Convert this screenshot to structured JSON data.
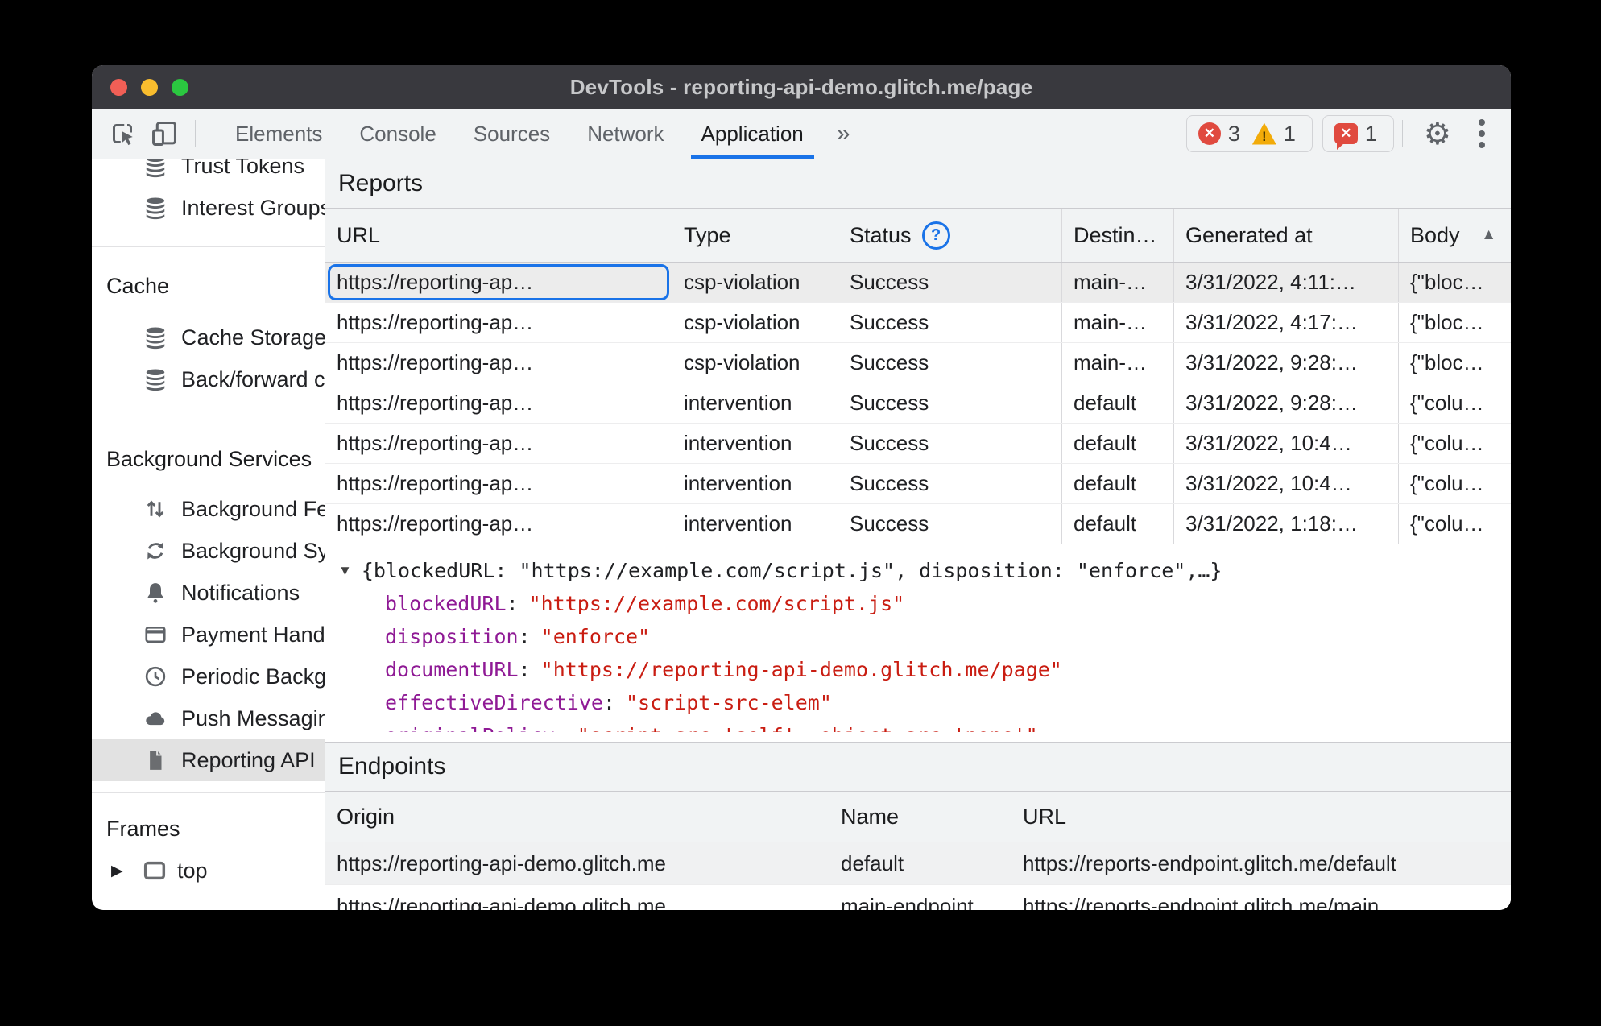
{
  "colors": {
    "accent": "#1a73e8",
    "error": "#e04a3f",
    "warning": "#f2ab09",
    "json_key": "#8f1a95",
    "json_string": "#c91d12",
    "titlebar": "#39393e",
    "toolbar_bg": "#f1f3f4"
  },
  "window": {
    "title": "DevTools - reporting-api-demo.glitch.me/page"
  },
  "toolbar": {
    "tabs": [
      "Elements",
      "Console",
      "Sources",
      "Network",
      "Application"
    ],
    "more": "»",
    "error_count": "3",
    "warning_count": "1",
    "issue_count": "1"
  },
  "sidebar": {
    "items_top": [
      "Trust Tokens",
      "Interest Groups"
    ],
    "cache_title": "Cache",
    "cache_items": [
      "Cache Storage",
      "Back/forward cache"
    ],
    "bg_title": "Background Services",
    "bg_items": [
      "Background Fetch",
      "Background Sync",
      "Notifications",
      "Payment Handler",
      "Periodic Background",
      "Push Messaging",
      "Reporting API"
    ],
    "frames_title": "Frames",
    "frames_items": [
      "top"
    ]
  },
  "reports": {
    "title": "Reports",
    "columns": {
      "url": "URL",
      "type": "Type",
      "status": "Status",
      "destination": "Destin…",
      "generated": "Generated at",
      "body": "Body"
    },
    "rows": [
      {
        "url": "https://reporting-ap…",
        "type": "csp-violation",
        "status": "Success",
        "destination": "main-…",
        "generated": "3/31/2022, 4:11:…",
        "body": "{\"bloc…"
      },
      {
        "url": "https://reporting-ap…",
        "type": "csp-violation",
        "status": "Success",
        "destination": "main-…",
        "generated": "3/31/2022, 4:17:…",
        "body": "{\"bloc…"
      },
      {
        "url": "https://reporting-ap…",
        "type": "csp-violation",
        "status": "Success",
        "destination": "main-…",
        "generated": "3/31/2022, 9:28:…",
        "body": "{\"bloc…"
      },
      {
        "url": "https://reporting-ap…",
        "type": "intervention",
        "status": "Success",
        "destination": "default",
        "generated": "3/31/2022, 9:28:…",
        "body": "{\"colu…"
      },
      {
        "url": "https://reporting-ap…",
        "type": "intervention",
        "status": "Success",
        "destination": "default",
        "generated": "3/31/2022, 10:4…",
        "body": "{\"colu…"
      },
      {
        "url": "https://reporting-ap…",
        "type": "intervention",
        "status": "Success",
        "destination": "default",
        "generated": "3/31/2022, 10:4…",
        "body": "{\"colu…"
      },
      {
        "url": "https://reporting-ap…",
        "type": "intervention",
        "status": "Success",
        "destination": "default",
        "generated": "3/31/2022, 1:18:…",
        "body": "{\"colu…"
      }
    ]
  },
  "detail": {
    "expander": "▼",
    "colon": ":",
    "preview": "{blockedURL: \"https://example.com/script.js\", disposition: \"enforce\",…}",
    "fields": [
      {
        "key": "blockedURL",
        "value": "\"https://example.com/script.js\""
      },
      {
        "key": "disposition",
        "value": "\"enforce\""
      },
      {
        "key": "documentURL",
        "value": "\"https://reporting-api-demo.glitch.me/page\""
      },
      {
        "key": "effectiveDirective",
        "value": "\"script-src-elem\""
      }
    ],
    "clipped_key": "originalPolicy",
    "clipped_value": "\"script-src 'self'; object-src 'none'\""
  },
  "endpoints": {
    "title": "Endpoints",
    "columns": {
      "origin": "Origin",
      "name": "Name",
      "url": "URL"
    },
    "rows": [
      {
        "origin": "https://reporting-api-demo.glitch.me",
        "name": "default",
        "url": "https://reports-endpoint.glitch.me/default"
      },
      {
        "origin": "https://reporting-api-demo.glitch.me",
        "name": "main-endpoint",
        "url": "https://reports-endpoint.glitch.me/main"
      }
    ]
  }
}
